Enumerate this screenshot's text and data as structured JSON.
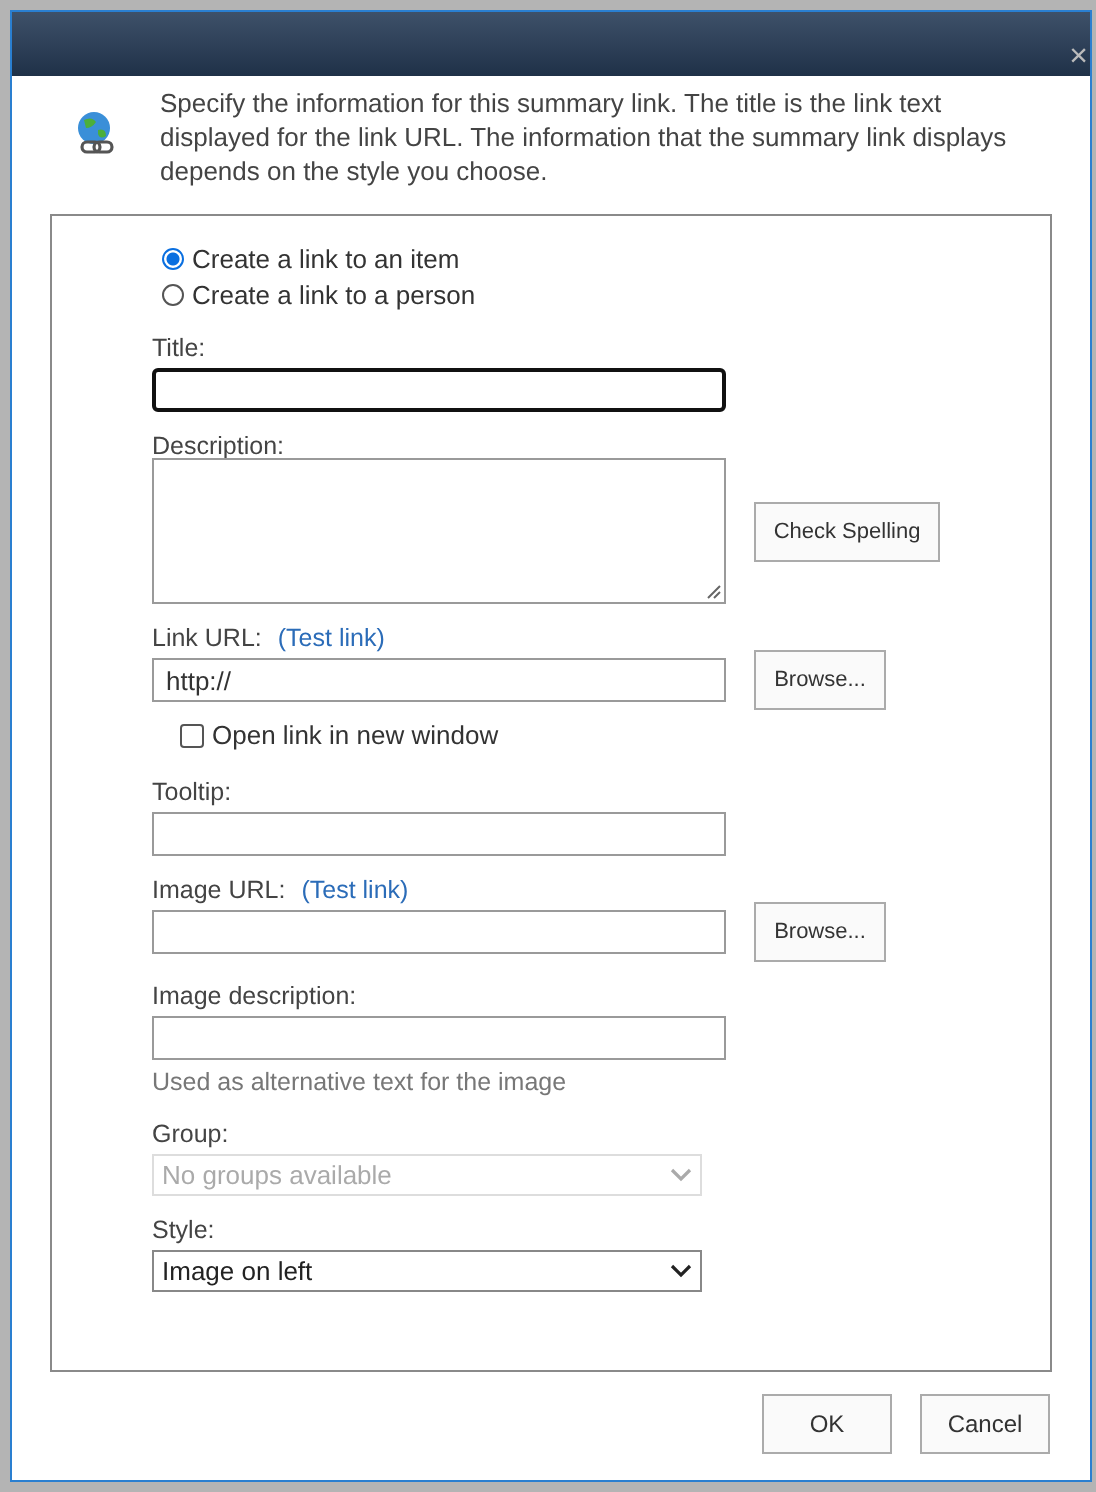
{
  "dialog": {
    "close": "×"
  },
  "intro": "Specify the information for this summary link. The title is the link text displayed for the link URL. The information that the summary link displays depends on the style you choose.",
  "link_type": [
    {
      "label": "Create a link to an item",
      "selected": true
    },
    {
      "label": "Create a link to a person",
      "selected": false
    }
  ],
  "title_field": {
    "label": "Title:",
    "focused": true
  },
  "description_field": {
    "label": "Description:",
    "button": "Check Spelling"
  },
  "link_url": {
    "label": "Link URL:",
    "test_link": "(Test link)",
    "value": "http://",
    "button": "Browse..."
  },
  "open_new_window": {
    "label": "Open link in new window",
    "checked": false
  },
  "tooltip": {
    "label": "Tooltip:"
  },
  "image_url": {
    "label": "Image URL:",
    "test_link": "(Test link)",
    "button": "Browse..."
  },
  "image_description": {
    "label": "Image description:",
    "hint": "Used as alternative text for the image"
  },
  "group": {
    "label": "Group:",
    "value": "No groups available",
    "disabled": true
  },
  "style": {
    "label": "Style:",
    "value": "Image on left",
    "disabled": false
  },
  "buttons": [
    "OK",
    "Cancel"
  ]
}
